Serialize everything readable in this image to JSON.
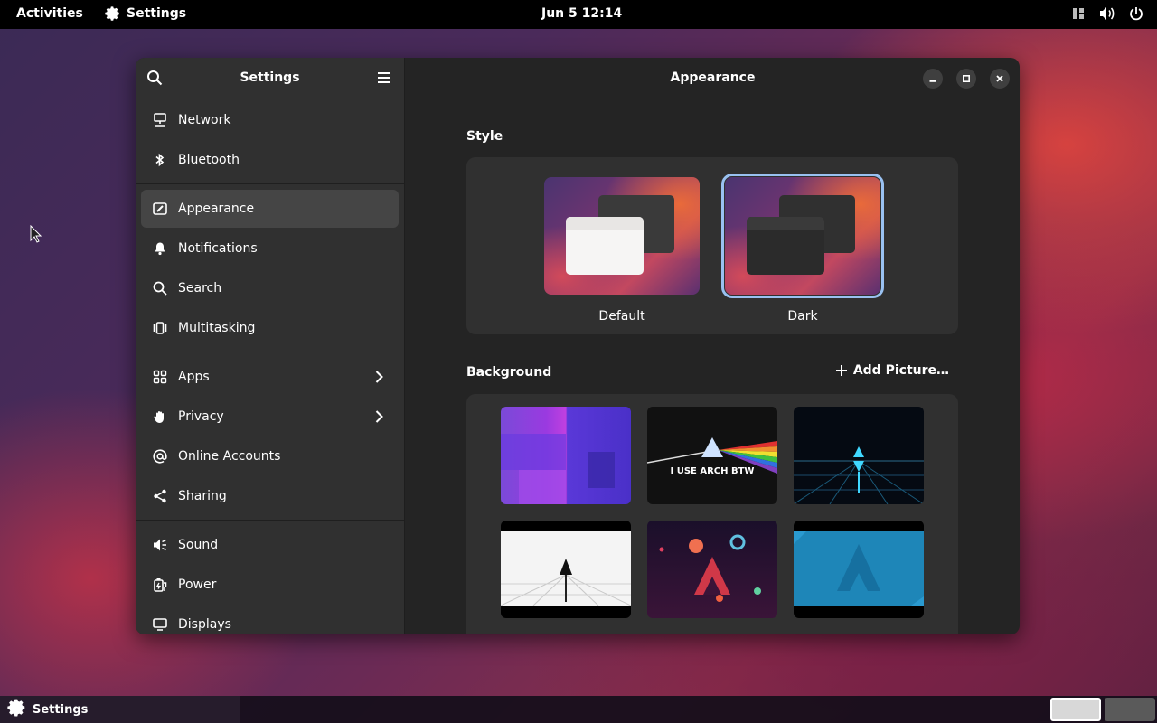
{
  "topbar": {
    "activities": "Activities",
    "app_name": "Settings",
    "clock": "Jun 5  12:14"
  },
  "sidebar": {
    "title": "Settings",
    "groups": [
      [
        {
          "label": "Network",
          "icon": "network-icon"
        },
        {
          "label": "Bluetooth",
          "icon": "bluetooth-icon"
        }
      ],
      [
        {
          "label": "Appearance",
          "icon": "appearance-icon",
          "selected": true
        },
        {
          "label": "Notifications",
          "icon": "bell-icon"
        },
        {
          "label": "Search",
          "icon": "search-icon"
        },
        {
          "label": "Multitasking",
          "icon": "multitasking-icon"
        }
      ],
      [
        {
          "label": "Apps",
          "icon": "apps-icon",
          "chevron": true
        },
        {
          "label": "Privacy",
          "icon": "hand-icon",
          "chevron": true
        },
        {
          "label": "Online Accounts",
          "icon": "at-icon"
        },
        {
          "label": "Sharing",
          "icon": "share-icon"
        }
      ],
      [
        {
          "label": "Sound",
          "icon": "speaker-icon"
        },
        {
          "label": "Power",
          "icon": "power-icon"
        },
        {
          "label": "Displays",
          "icon": "display-icon"
        }
      ]
    ]
  },
  "content": {
    "title": "Appearance",
    "style_section": "Style",
    "style_options": [
      {
        "label": "Default",
        "selected": false
      },
      {
        "label": "Dark",
        "selected": true
      }
    ],
    "background_section": "Background",
    "add_picture": "Add Picture…",
    "backgrounds": [
      {
        "name": "abstract-purple-wallpaper",
        "text": ""
      },
      {
        "name": "arch-prism-wallpaper",
        "text": "I USE ARCH BTW"
      },
      {
        "name": "arch-neon-grid-wallpaper",
        "text": ""
      },
      {
        "name": "arch-white-grid-wallpaper",
        "text": ""
      },
      {
        "name": "arch-space-planets-wallpaper",
        "text": ""
      },
      {
        "name": "arch-blue-wallpaper",
        "text": ""
      }
    ]
  },
  "taskbar": {
    "app_label": "Settings"
  },
  "colors": {
    "accent": "#99c1f1",
    "sidebar_bg": "#303030",
    "content_bg": "#242424",
    "selected_row": "#454545"
  }
}
